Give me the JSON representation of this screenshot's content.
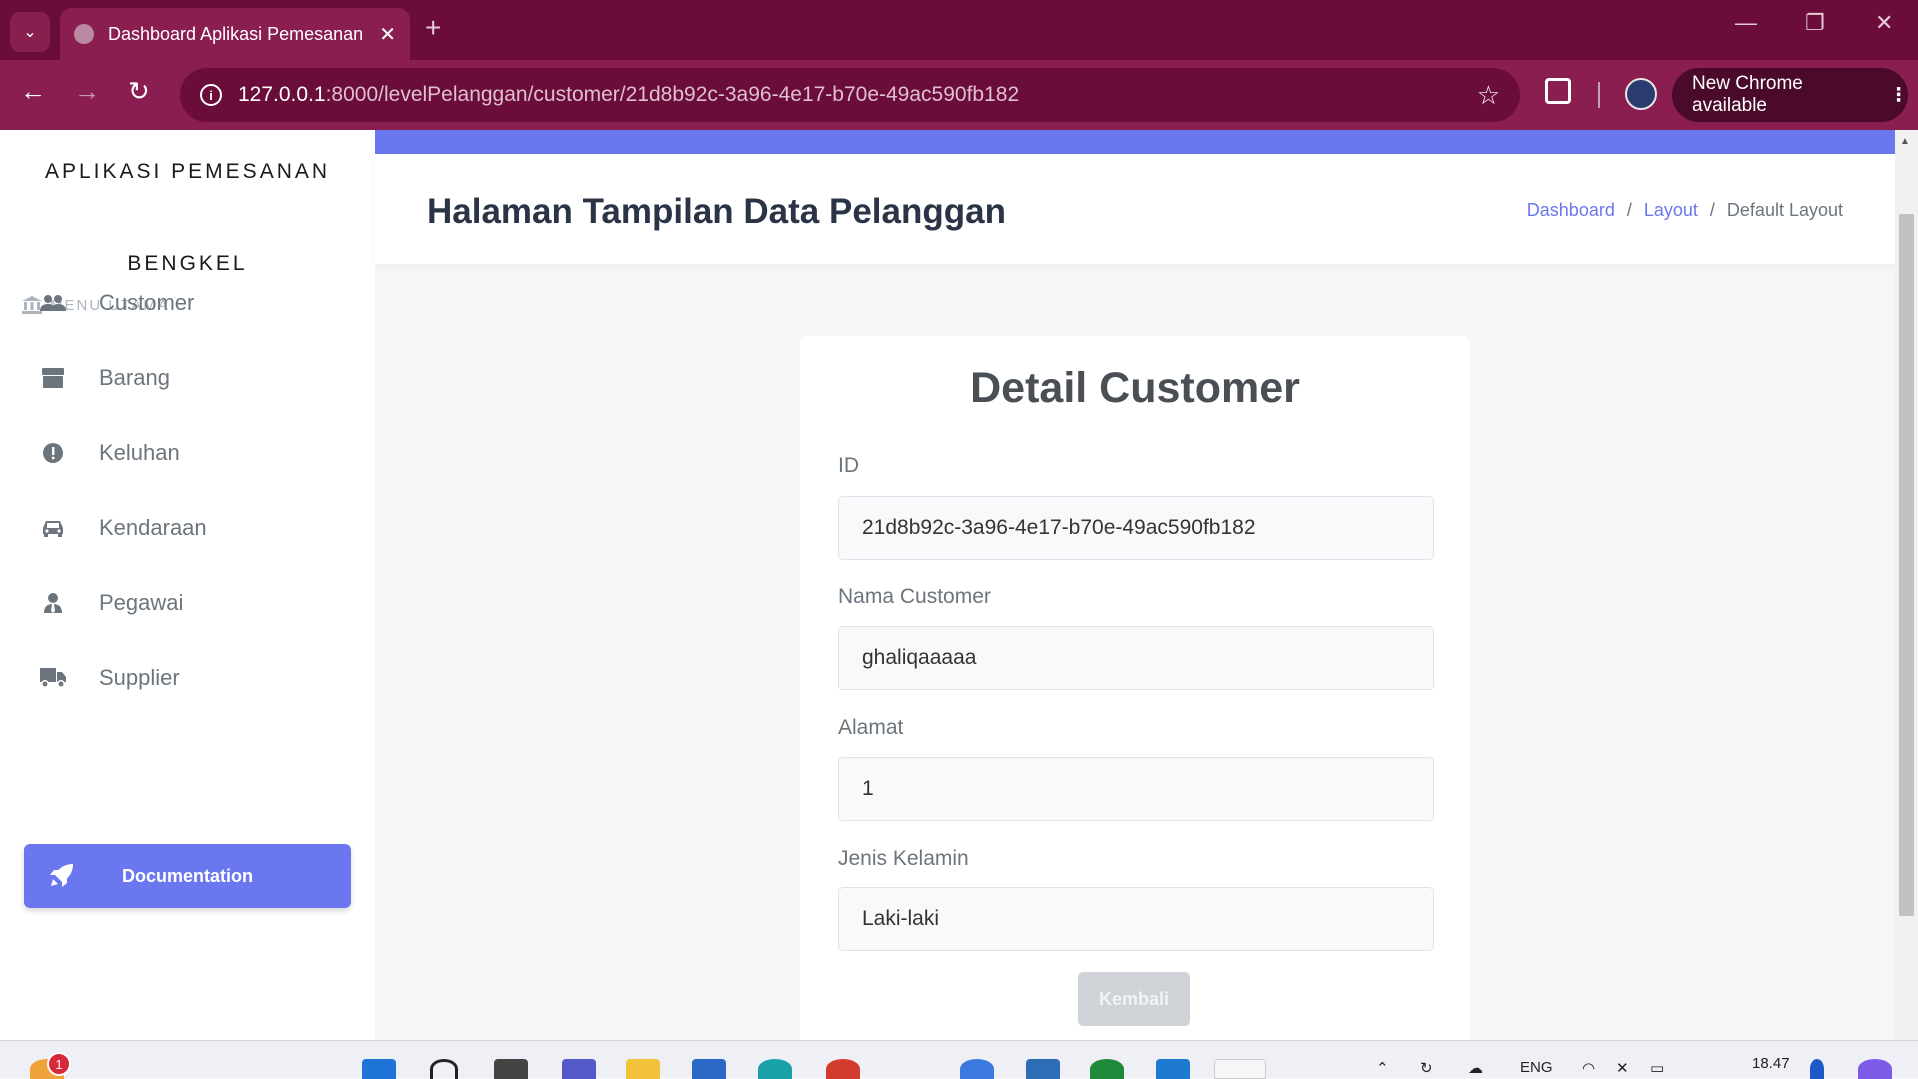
{
  "browser": {
    "tab_title": "Dashboard Aplikasi Pemesanan",
    "tab_close": "✕",
    "new_tab": "+",
    "url_host": "127.0.0.1",
    "url_path": ":8000/levelPelanggan/customer/21d8b92c-3a96-4e17-b70e-49ac590fb182",
    "update_label": "New Chrome available",
    "update_menu": "⋮"
  },
  "sidebar": {
    "brand_line1": "APLIKASI PEMESANAN",
    "brand_line2": "BENGKEL",
    "menu_header": "MENU UTAMA",
    "items": [
      {
        "label": "Customer",
        "icon": "users-icon"
      },
      {
        "label": "Barang",
        "icon": "box-icon"
      },
      {
        "label": "Keluhan",
        "icon": "alert-circle-icon"
      },
      {
        "label": "Kendaraan",
        "icon": "car-icon"
      },
      {
        "label": "Pegawai",
        "icon": "user-tie-icon"
      },
      {
        "label": "Supplier",
        "icon": "truck-icon"
      }
    ],
    "doc_button": "Documentation"
  },
  "header": {
    "title": "Halaman Tampilan Data Pelanggan",
    "breadcrumb": [
      "Dashboard",
      "Layout",
      "Default Layout"
    ],
    "separator": "/"
  },
  "card": {
    "title": "Detail Customer",
    "fields": [
      {
        "label": "ID",
        "value": "21d8b92c-3a96-4e17-b70e-49ac590fb182"
      },
      {
        "label": "Nama Customer",
        "value": "ghaliqaaaaa"
      },
      {
        "label": "Alamat",
        "value": "1"
      },
      {
        "label": "Jenis Kelamin",
        "value": "Laki-laki"
      }
    ],
    "back_button": "Kembali"
  },
  "taskbar": {
    "notification_count": "1",
    "lang": "ENG",
    "time": "18.47"
  },
  "colors": {
    "accent": "#6b77ee",
    "chrome_frame": "#6a0d3a",
    "chrome_toolbar": "#8a1e50"
  }
}
